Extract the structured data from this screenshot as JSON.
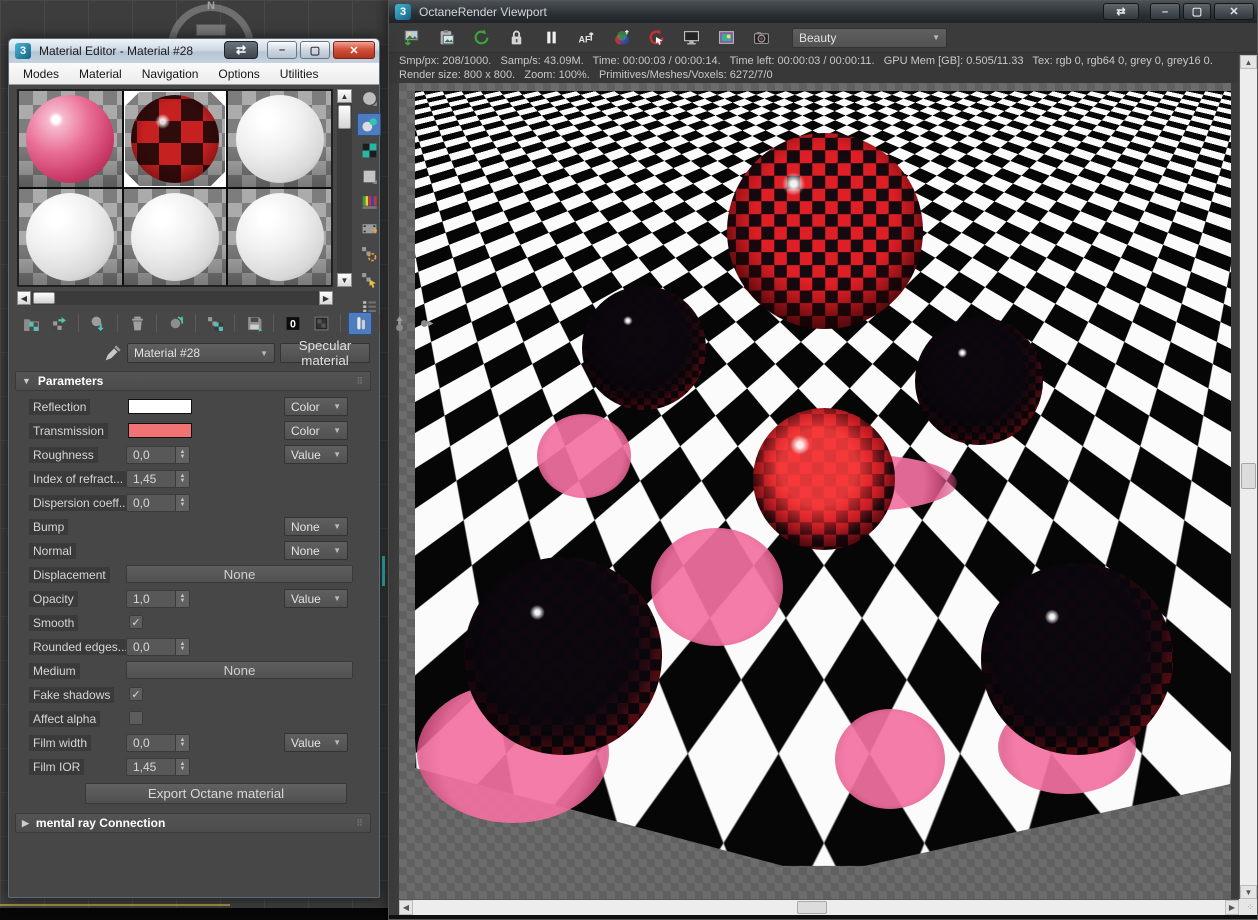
{
  "background": {
    "compass_label": "N"
  },
  "material_editor": {
    "logo": "3",
    "title": "Material Editor - Material #28",
    "window_buttons": {
      "swap": "⇆",
      "minimize": "—",
      "maximize": "❐",
      "close": "✕"
    },
    "menus": [
      "Modes",
      "Material",
      "Navigation",
      "Options",
      "Utilities"
    ],
    "sample_slots": [
      {
        "type": "pink-glossy",
        "selected": false
      },
      {
        "type": "red-checker",
        "selected": true
      },
      {
        "type": "white-matte",
        "selected": false
      },
      {
        "type": "white-matte",
        "selected": false
      },
      {
        "type": "white-matte",
        "selected": false
      },
      {
        "type": "white-matte",
        "selected": false
      }
    ],
    "toolbar_icons": [
      {
        "name": "get-material",
        "active": false
      },
      {
        "name": "put-material-to-scene",
        "active": false
      },
      {
        "name": "assign-material-to-selection",
        "active": false
      },
      {
        "name": "reset-material",
        "active": false
      },
      {
        "name": "make-material-copy",
        "active": false
      },
      {
        "name": "make-unique",
        "active": false
      },
      {
        "name": "put-to-library",
        "active": false
      },
      {
        "name": "material-id-channel",
        "active": false
      },
      {
        "name": "show-shaded-material-in-viewport",
        "active": false
      },
      {
        "name": "show-end-result",
        "active": true
      },
      {
        "name": "go-to-parent",
        "active": false
      },
      {
        "name": "go-forward-to-sibling",
        "active": false
      }
    ],
    "side_toolbar_icons": [
      {
        "name": "sample-type",
        "active": false
      },
      {
        "name": "backlight",
        "active": true
      },
      {
        "name": "background",
        "active": false
      },
      {
        "name": "sample-uv-tiling",
        "active": false
      },
      {
        "name": "video-color-check",
        "active": false
      },
      {
        "name": "make-preview",
        "active": false
      },
      {
        "name": "material-editor-options",
        "active": false
      },
      {
        "name": "select-by-material",
        "active": false
      },
      {
        "name": "material-map-navigator",
        "active": false
      }
    ],
    "material_name": "Material #28",
    "material_type": "Specular material",
    "parameters": {
      "title": "Parameters",
      "rows": [
        {
          "label": "Reflection",
          "control": "swatch",
          "swatch": "#ffffff",
          "right": "Color"
        },
        {
          "label": "Transmission",
          "control": "swatch",
          "swatch": "#f17373",
          "right": "Color"
        },
        {
          "label": "Roughness",
          "control": "spinner",
          "value": "0,0",
          "right": "Value"
        },
        {
          "label": "Index of refract...",
          "control": "spinner",
          "value": "1,45",
          "right": null
        },
        {
          "label": "Dispersion coeff...",
          "control": "spinner",
          "value": "0,0",
          "right": null
        },
        {
          "label": "Bump",
          "control": "none",
          "right": "None"
        },
        {
          "label": "Normal",
          "control": "none",
          "right": "None"
        },
        {
          "label": "Displacement",
          "control": "widebutton",
          "value": "None",
          "right": null
        },
        {
          "label": "Opacity",
          "control": "spinner",
          "value": "1,0",
          "right": "Value"
        },
        {
          "label": "Smooth",
          "control": "check",
          "checked": true
        },
        {
          "label": "Rounded edges...",
          "control": "spinner",
          "value": "0,0",
          "right": null
        },
        {
          "label": "Medium",
          "control": "widebutton",
          "value": "None",
          "right": null
        },
        {
          "label": "Fake shadows",
          "control": "check",
          "checked": true
        },
        {
          "label": "Affect alpha",
          "control": "check",
          "checked": false
        },
        {
          "label": "Film width",
          "control": "spinner",
          "value": "0,0",
          "right": "Value"
        },
        {
          "label": "Film IOR",
          "control": "spinner",
          "value": "1,45",
          "right": null
        }
      ]
    },
    "export_button": "Export Octane material",
    "mental_ray_rollout": "mental ray Connection"
  },
  "octane": {
    "logo": "3",
    "title": "OctaneRender Viewport",
    "window_buttons": {
      "swap": "⇆",
      "minimize": "—",
      "maximize": "❐",
      "close": "✕"
    },
    "toolbar_icons": [
      {
        "name": "save-image"
      },
      {
        "name": "copy-to-clipboard"
      },
      {
        "name": "refresh-render"
      },
      {
        "name": "lock-resolution"
      },
      {
        "name": "pause-render"
      },
      {
        "name": "autofocus"
      },
      {
        "name": "white-balance-picker"
      },
      {
        "name": "restart-render"
      },
      {
        "name": "viewport-render"
      },
      {
        "name": "render-target"
      },
      {
        "name": "camera"
      }
    ],
    "render_pass": "Beauty",
    "status_line1": "Smp/px: 208/1000.   Samp/s: 43.09M.   Time: 00:00:03 / 00:00:14.   Time left: 00:00:03 / 00:00:11.   GPU Mem [GB]: 0.505/11.33   Tex: rgb 0, rgb64 0, grey 0, grey16 0.",
    "status_line2": "Render size: 800 x 800.   Zoom: 100%.   Primitives/Meshes/Voxels: 6272/7/0"
  },
  "colors": {
    "accent_teal": "#54c3b5",
    "selection_blue": "#4f7cbf",
    "transmission_pink": "#f17373",
    "caustic_pink": "#f271a0",
    "sphere_red": "#df1f26"
  }
}
